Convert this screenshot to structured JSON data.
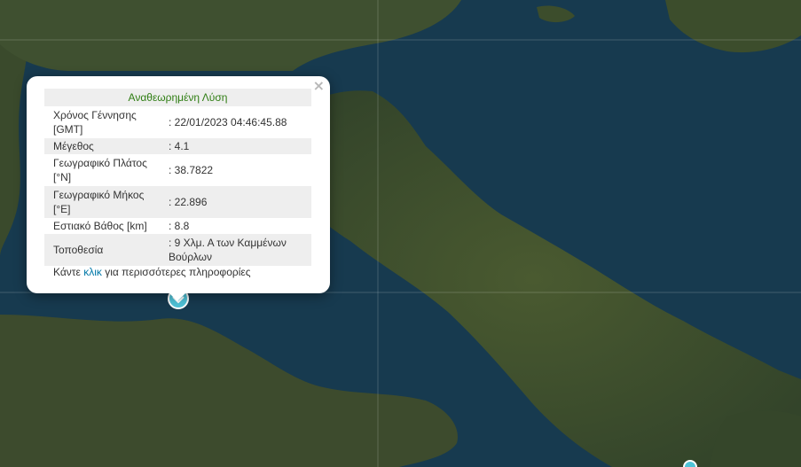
{
  "popup": {
    "close_symbol": "×",
    "title": "Αναθεωρημένη Λύση",
    "rows": [
      {
        "label": "Χρόνος Γέννησης [GMT]",
        "value": ": 22/01/2023 04:46:45.88"
      },
      {
        "label": "Μέγεθος",
        "value": ": 4.1"
      },
      {
        "label": "Γεωγραφικό Πλάτος [°N]",
        "value": ": 38.7822"
      },
      {
        "label": "Γεωγραφικό Μήκος [°E]",
        "value": ": 22.896"
      },
      {
        "label": "Εστιακό Βάθος [km]",
        "value": ": 8.8"
      },
      {
        "label": "Τοποθεσία",
        "value": ": 9 Χλμ. Α των Καμμένων Βούρλων"
      }
    ],
    "more_prefix": "Κάντε ",
    "more_link": "κλικ",
    "more_suffix": " για περισσότερες πληροφορίες"
  },
  "map": {
    "style": "satellite",
    "sea_color": "#173a4f",
    "land_color": "#3e4f2a",
    "marker_color": "#4fc3d8",
    "markers": [
      {
        "icon": "earthquake-marker-icon",
        "selected": true
      },
      {
        "icon": "earthquake-marker-icon",
        "selected": false
      }
    ]
  }
}
